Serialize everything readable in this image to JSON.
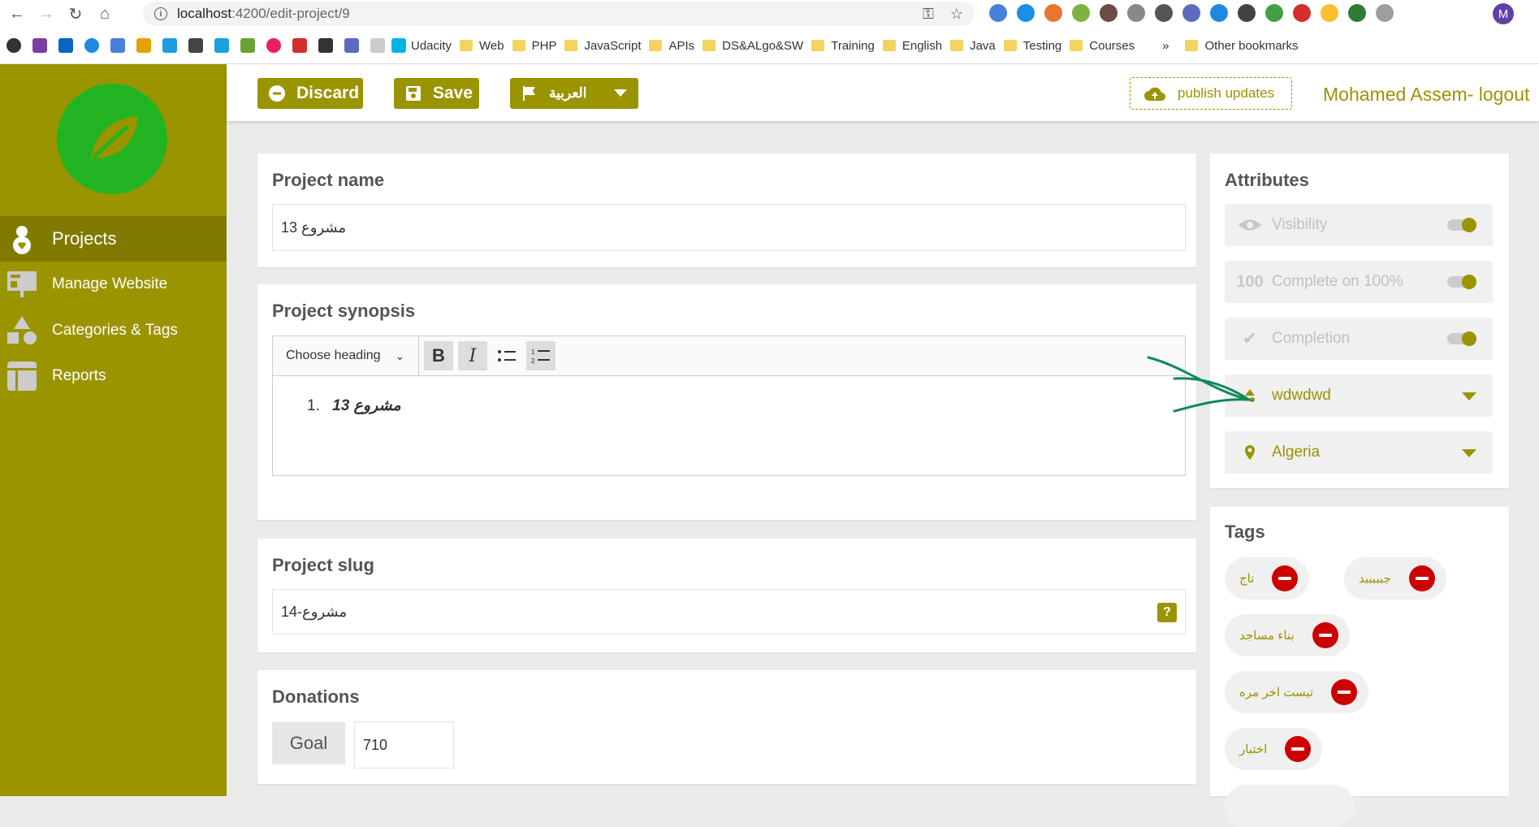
{
  "browser": {
    "url_host": "localhost",
    "url_path": ":4200/edit-project/9",
    "profile_initial": "M",
    "bookmarks": [
      "Udacity",
      "Web",
      "PHP",
      "JavaScript",
      "APIs",
      "DS&ALgo&SW",
      "Training",
      "English",
      "Java",
      "Testing",
      "Courses"
    ],
    "more": "»",
    "other_bookmarks": "Other bookmarks"
  },
  "sidebar": {
    "items": [
      {
        "label": "Projects"
      },
      {
        "label": "Manage Website"
      },
      {
        "label": "Categories & Tags"
      },
      {
        "label": "Reports"
      }
    ]
  },
  "topbar": {
    "discard_label": "Discard",
    "save_label": "Save",
    "language_label": "العربية",
    "publish_label": "publish updates",
    "user_label": "Mohamed Assem- logout"
  },
  "project_name": {
    "title": "Project name",
    "value": "مشروع 13"
  },
  "synopsis": {
    "title": "Project synopsis",
    "heading_select": "Choose heading",
    "list_number": "1.",
    "list_text": "مشروع 13"
  },
  "slug": {
    "title": "Project slug",
    "value": "مشروع-14",
    "help": "?"
  },
  "donations": {
    "title": "Donations",
    "goal_label": "Goal",
    "goal_value": "710"
  },
  "attributes": {
    "title": "Attributes",
    "visibility": "Visibility",
    "complete": "Complete on 100%",
    "completion": "Completion",
    "category": "wdwdwd",
    "country": "Algeria"
  },
  "tags": {
    "title": "Tags",
    "items": [
      "تاج",
      "جبببببد",
      "بناء مساجد",
      "تيست اخر مره",
      "اختبار"
    ]
  },
  "colors": {
    "accent": "#9a9400",
    "logo": "#22b422",
    "remove": "#cc0000"
  }
}
